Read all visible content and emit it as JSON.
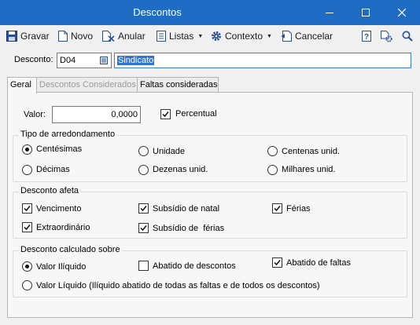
{
  "window": {
    "title": "Descontos"
  },
  "toolbar": {
    "save": "Gravar",
    "new": "Novo",
    "cancel_item": "Anular",
    "lists": "Listas",
    "context": "Contexto",
    "cancel": "Cancelar"
  },
  "form": {
    "desconto_label": "Desconto:",
    "code": "D04",
    "description": "Sindicato"
  },
  "tabs": [
    "Geral",
    "Descontos Considerados",
    "Faltas consideradas"
  ],
  "geral": {
    "valor_label": "Valor:",
    "valor": "0,0000",
    "percentual_label": "Percentual",
    "percentual_checked": true,
    "rounding": {
      "title": "Tipo de arredondamento",
      "options": [
        "Centésimas",
        "Unidade",
        "Centenas unid.",
        "Décimas",
        "Dezenas unid.",
        "Milhares unid."
      ],
      "selected": "Centésimas"
    },
    "affects": {
      "title": "Desconto afeta",
      "options": [
        {
          "label": "Vencimento",
          "checked": true
        },
        {
          "label": "Subsídio de natal",
          "checked": true
        },
        {
          "label": "Férias",
          "checked": true
        },
        {
          "label": "Extraordinário",
          "checked": true
        },
        {
          "label": "Subsídio de  férias",
          "checked": true
        }
      ]
    },
    "calc": {
      "title": "Desconto calculado sobre",
      "options": [
        "Valor Ilíquido",
        "Valor Líquido (Ilíquido abatido de todas as faltas e de todos os descontos)"
      ],
      "selected": "Valor Ilíquido",
      "checks": [
        {
          "label": "Abatido de descontos",
          "checked": false
        },
        {
          "label": "Abatido de faltas",
          "checked": true
        }
      ]
    }
  }
}
